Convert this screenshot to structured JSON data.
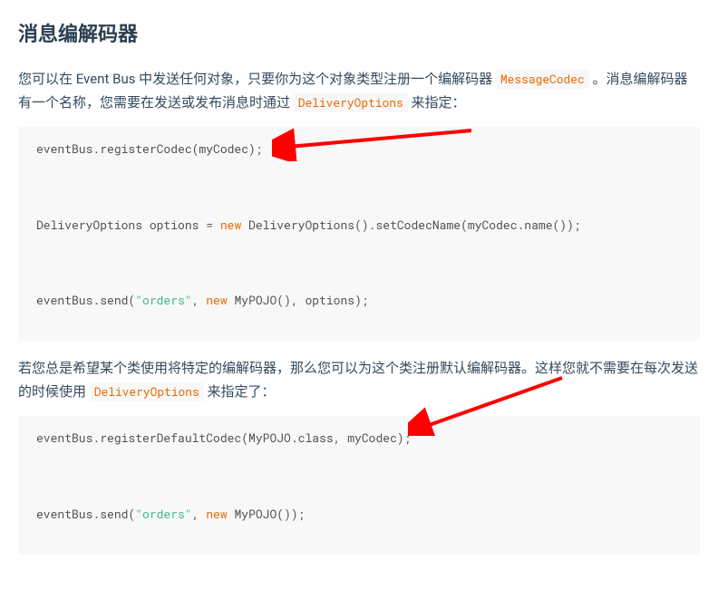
{
  "heading": "消息编解码器",
  "para1": {
    "t1": "您可以在 Event Bus 中发送任何对象，只要你为这个对象类型注册一个编解码器 ",
    "code1": "MessageCodec",
    "t2": " 。消息编解码器有一个名称，您需要在发送或发布消息时通过 ",
    "code2": "DeliveryOptions",
    "t3": " 来指定："
  },
  "code1": {
    "l1": "eventBus.registerCodec(myCodec);",
    "l2": "",
    "l3_a": "DeliveryOptions options = ",
    "l3_kw": "new",
    "l3_b": " DeliveryOptions().setCodecName(myCodec.name());",
    "l4": "",
    "l5_a": "eventBus.send(",
    "l5_s": "\"orders\"",
    "l5_b": ", ",
    "l5_kw": "new",
    "l5_c": " MyPOJO(), options);"
  },
  "para2": {
    "t1": "若您总是希望某个类使用将特定的编解码器，那么您可以为这个类注册默认编解码器。这样您就不需要在每次发送的时候使用 ",
    "code1": "DeliveryOptions",
    "t2": " 来指定了："
  },
  "code2": {
    "l1": "eventBus.registerDefaultCodec(MyPOJO.class, myCodec);",
    "l2": "",
    "l3_a": "eventBus.send(",
    "l3_s": "\"orders\"",
    "l3_b": ", ",
    "l3_kw": "new",
    "l3_c": " MyPOJO());"
  }
}
